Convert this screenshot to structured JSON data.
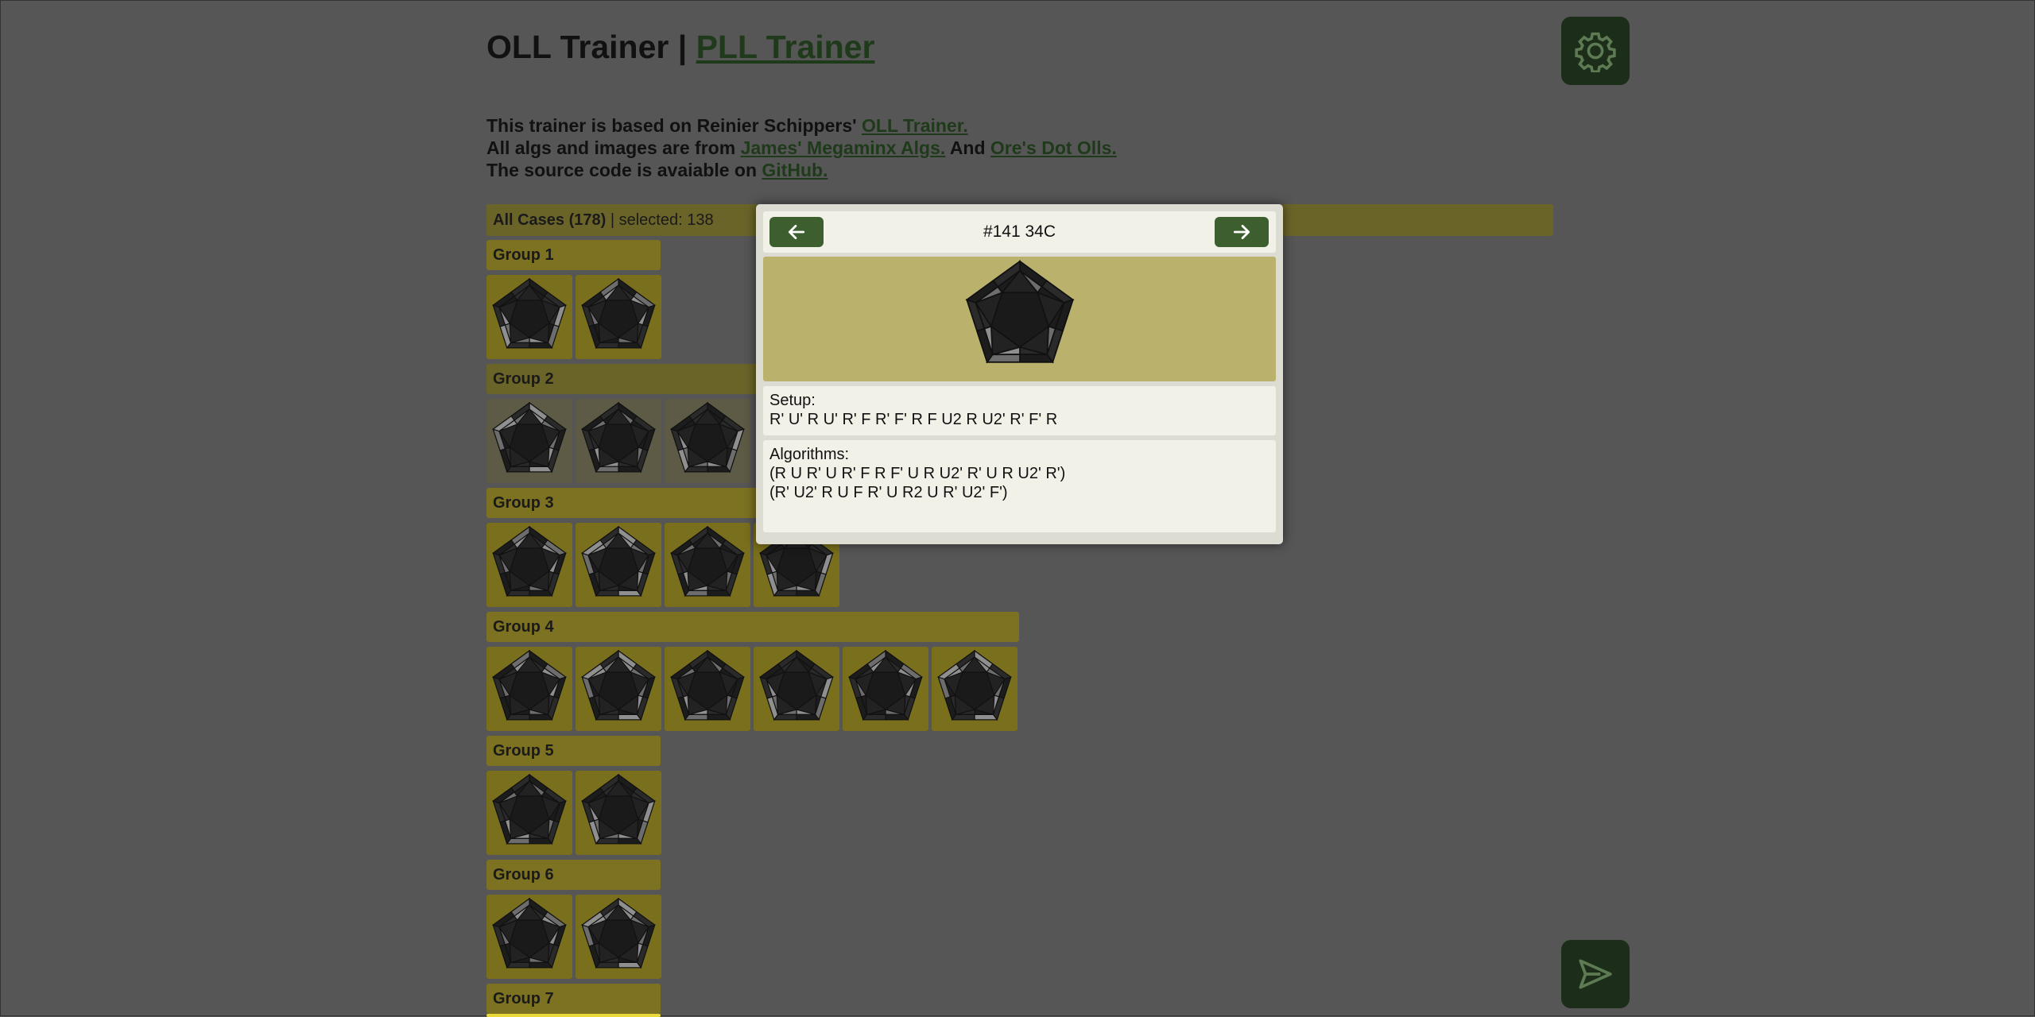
{
  "header": {
    "title_prefix": "OLL Trainer | ",
    "title_link": "PLL Trainer",
    "intro": [
      {
        "text": "This trainer is based on Reinier Schippers' ",
        "link": "OLL Trainer.",
        "mid": "",
        "link2": ""
      },
      {
        "text": "All algs and images are from ",
        "link": "James' Megaminx Algs.",
        "mid": " And ",
        "link2": "Ore's Dot Olls."
      },
      {
        "text": "The source code is avaiable on ",
        "link": "GitHub.",
        "mid": "",
        "link2": ""
      }
    ]
  },
  "icons": {
    "settings": "gear-icon",
    "send": "send-icon",
    "prev": "arrow-left-icon",
    "next": "arrow-right-icon"
  },
  "colors": {
    "background": "#565656",
    "accent_green": "#3d5e2f",
    "group_yellow": "#7c7222",
    "image_bg": "#bab26c"
  },
  "summary": {
    "label": "All Cases (178)",
    "selected": " | selected: 138"
  },
  "groups": [
    {
      "label": "Group 1",
      "count": 2
    },
    {
      "label": "Group 2",
      "count": 3
    },
    {
      "label": "Group 3",
      "count": 4
    },
    {
      "label": "Group 4",
      "count": 6
    },
    {
      "label": "Group 5",
      "count": 2
    },
    {
      "label": "Group 6",
      "count": 2
    },
    {
      "label": "Group 7",
      "count": 0
    }
  ],
  "modal": {
    "case_title": "#141 34C",
    "setup_label": "Setup:",
    "setup": "R' U' R U' R' F R' F' R F U2 R U2' R' F' R",
    "algorithms_label": "Algorithms:",
    "algorithms": [
      "(R U R' U R' F R F' U R U2' R' U R U2' R')",
      "(R' U2' R U F R' U R2 U R' U2' F')"
    ]
  }
}
